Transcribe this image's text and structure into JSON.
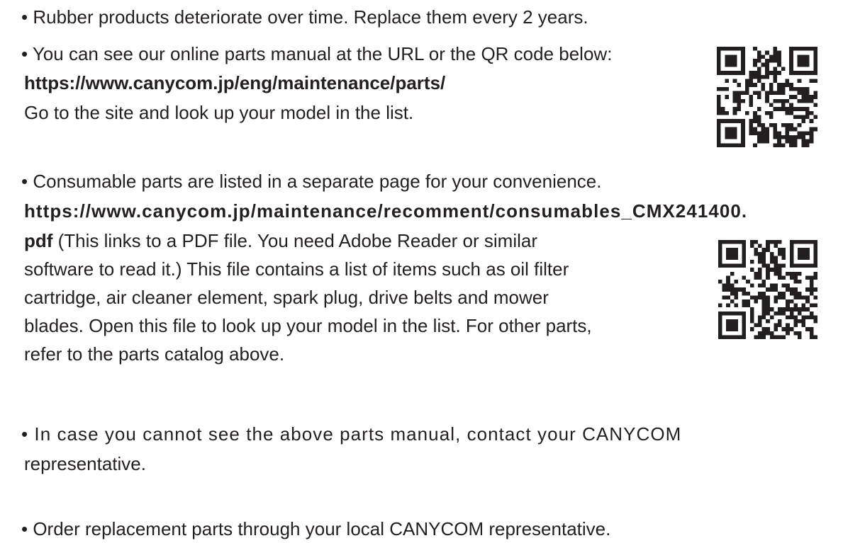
{
  "notes": [
    {
      "id": "rubber",
      "lines": [
        "• Rubber products deteriorate over time. Replace them every 2 years."
      ]
    },
    {
      "id": "online-manual",
      "lines": [
        "• You can see our online parts manual at the URL or the QR code below:",
        "https://www.canycom.jp/eng/maintenance/parts/",
        "Go to the site and look up your model in the list."
      ]
    },
    {
      "id": "consumables",
      "lines": [
        "• Consumable parts are listed in a separate page for your convenience.",
        "https://www.canycom.jp/maintenance/recomment/consumables_CMX241400.",
        "pdf",
        " (This links to a PDF file. You need Adobe Reader or similar",
        "software to read it.) This file contains a list of items such as oil filter",
        "cartridge, air cleaner element, spark plug, drive belts and mower",
        "blades. Open this file to look up your model in the list. For other parts,",
        "refer to the parts catalog above."
      ]
    },
    {
      "id": "contact",
      "lines": [
        "• In case you cannot see the above parts manual, contact your CANYCOM",
        "representative."
      ]
    },
    {
      "id": "order",
      "lines": [
        "• Order replacement parts through your local CANYCOM representative."
      ]
    }
  ],
  "qr_codes": [
    {
      "name": "parts-manual-qr-icon",
      "color": "#231f20"
    },
    {
      "name": "consumables-qr-icon",
      "color": "#231f20"
    }
  ]
}
